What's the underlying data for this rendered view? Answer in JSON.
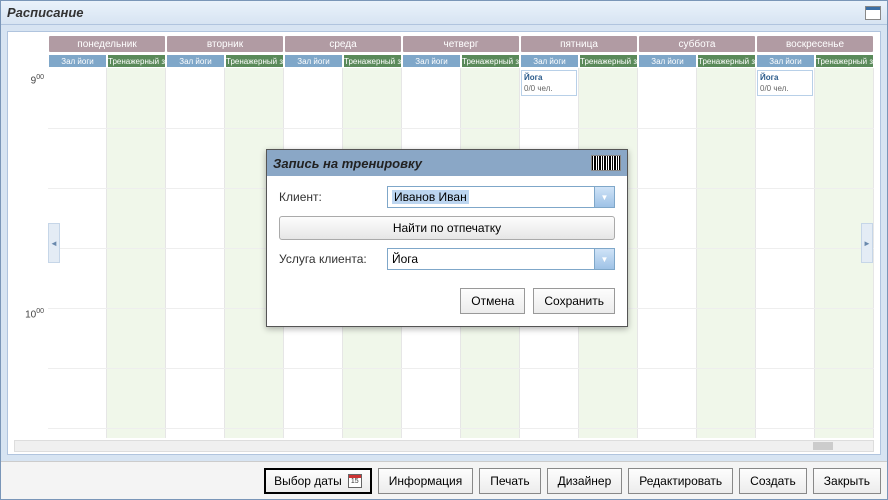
{
  "window": {
    "title": "Расписание"
  },
  "days": [
    "понедельник",
    "вторник",
    "среда",
    "четверг",
    "пятница",
    "суббота",
    "воскресенье"
  ],
  "rooms": {
    "a": "Зал йоги",
    "b": "Тренажерный зал"
  },
  "times": {
    "t9": "9",
    "t9m": "00",
    "t10": "10",
    "t10m": "00"
  },
  "events": {
    "friday_yoga": {
      "title": "Йога",
      "sub": "0/0 чел."
    },
    "sunday_yoga": {
      "title": "Йога",
      "sub": "0/0 чел."
    }
  },
  "footer": {
    "date_picker": "Выбор даты",
    "cal_day": "15",
    "info": "Информация",
    "print": "Печать",
    "designer": "Дизайнер",
    "edit": "Редактировать",
    "create": "Создать",
    "close": "Закрыть"
  },
  "modal": {
    "title": "Запись на тренировку",
    "client_label": "Клиент:",
    "client_value": "Иванов Иван",
    "fingerprint_btn": "Найти по отпечатку",
    "service_label": "Услуга клиента:",
    "service_value": "Йога",
    "cancel": "Отмена",
    "save": "Сохранить"
  }
}
